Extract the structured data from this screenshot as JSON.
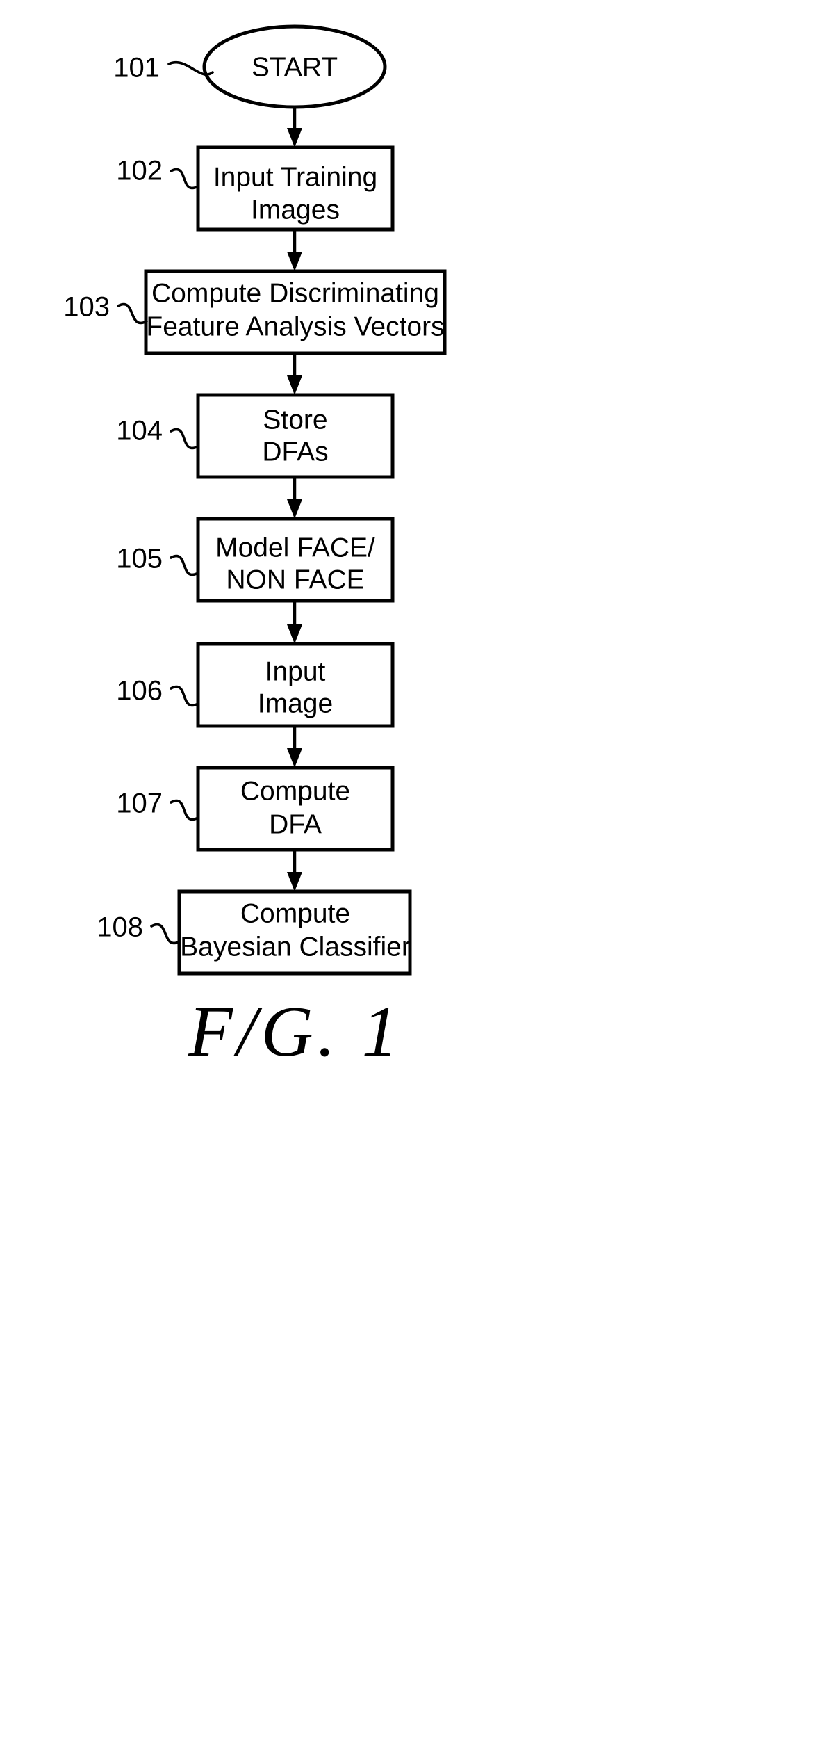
{
  "figure": {
    "caption": "F/G. 1",
    "title": "Face detection training and classification flowchart"
  },
  "flowchart": {
    "type": "flowchart",
    "orientation": "vertical",
    "nodes": [
      {
        "ref": "101",
        "shape": "ellipse",
        "lines": [
          "START"
        ],
        "text": "START"
      },
      {
        "ref": "102",
        "shape": "rectangle",
        "lines": [
          "Input Training",
          "Images"
        ],
        "text": "Input Training Images"
      },
      {
        "ref": "103",
        "shape": "rectangle",
        "lines": [
          "Compute Discriminating",
          "Feature Analysis Vectors"
        ],
        "text": "Compute Discriminating Feature Analysis Vectors"
      },
      {
        "ref": "104",
        "shape": "rectangle",
        "lines": [
          "Store",
          "DFAs"
        ],
        "text": "Store DFAs"
      },
      {
        "ref": "105",
        "shape": "rectangle",
        "lines": [
          "Model FACE/",
          "NON FACE"
        ],
        "text": "Model FACE/ NON FACE"
      },
      {
        "ref": "106",
        "shape": "rectangle",
        "lines": [
          "Input",
          "Image"
        ],
        "text": "Input Image"
      },
      {
        "ref": "107",
        "shape": "rectangle",
        "lines": [
          "Compute",
          "DFA"
        ],
        "text": "Compute DFA"
      },
      {
        "ref": "108",
        "shape": "rectangle",
        "lines": [
          "Compute",
          "Bayesian Classifier"
        ],
        "text": "Compute Bayesian Classifier"
      }
    ],
    "edges": [
      {
        "from": "101",
        "to": "102",
        "style": "arrow"
      },
      {
        "from": "102",
        "to": "103",
        "style": "arrow"
      },
      {
        "from": "103",
        "to": "104",
        "style": "arrow"
      },
      {
        "from": "104",
        "to": "105",
        "style": "arrow"
      },
      {
        "from": "105",
        "to": "106",
        "style": "arrow"
      },
      {
        "from": "106",
        "to": "107",
        "style": "arrow"
      },
      {
        "from": "107",
        "to": "108",
        "style": "arrow"
      }
    ]
  },
  "colors": {
    "ink": "#000000",
    "paper": "#ffffff"
  }
}
